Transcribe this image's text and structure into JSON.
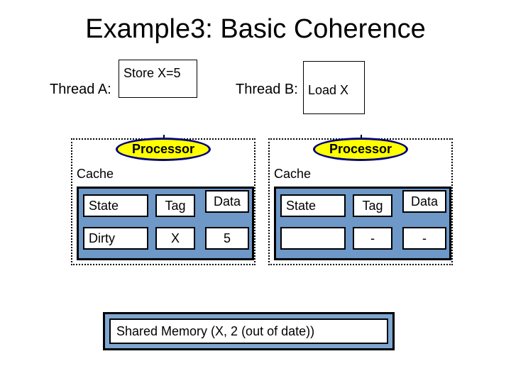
{
  "title": "Example3: Basic Coherence",
  "threadA": {
    "label": "Thread A:",
    "instr": "Store X=5"
  },
  "threadB": {
    "label": "Thread B:",
    "instr": "\nLoad X"
  },
  "processor_label": "Processor",
  "cache_label": "Cache",
  "table": {
    "headers": {
      "state": "State",
      "tag": "Tag",
      "data": "Data"
    },
    "rowA": {
      "state": "Dirty",
      "tag": "X",
      "data": "5"
    },
    "rowB": {
      "state": "",
      "tag": "-",
      "data": "-"
    }
  },
  "shared_memory": "Shared Memory (X, 2 (out of date))"
}
